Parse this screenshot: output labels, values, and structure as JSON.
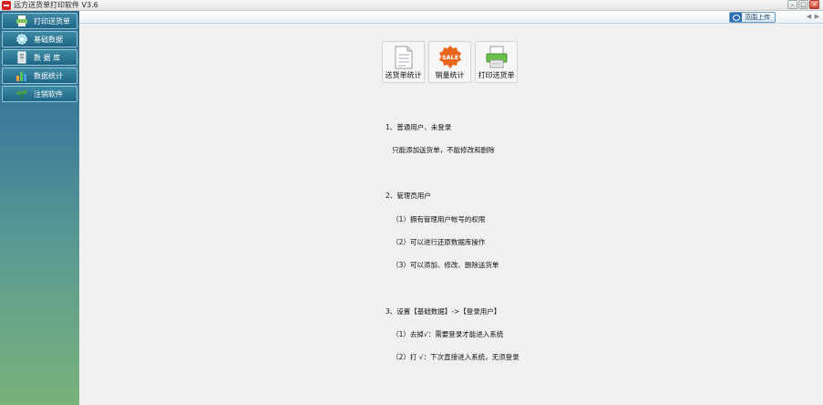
{
  "window": {
    "title": "远方送货单打印软件 V3.6",
    "controls": [
      "–",
      "□",
      "×"
    ]
  },
  "sidebar": {
    "items": [
      {
        "label": "打印送货单",
        "icon": "printer-icon"
      },
      {
        "label": "基础数据",
        "icon": "gear-icon"
      },
      {
        "label": "数 据 库",
        "icon": "database-icon"
      },
      {
        "label": "数据统计",
        "icon": "bar-chart-icon"
      },
      {
        "label": "注销软件",
        "icon": "plant-icon"
      }
    ]
  },
  "toolbar": {
    "upload_label": "范围上传",
    "nav_prev": "◀",
    "nav_next": "▶"
  },
  "tiles": [
    {
      "label": "送货单统计",
      "icon": "document-icon"
    },
    {
      "label": "销量统计",
      "icon": "sale-badge-icon",
      "badge_text": "SALE"
    },
    {
      "label": "打印送货单",
      "icon": "printer-icon"
    }
  ],
  "notes": [
    {
      "lines": [
        "1、普通用户、未登录",
        "   只能添加送货单，不能修改和删除"
      ]
    },
    {
      "lines": [
        "2、管理员用户",
        "   （1）拥有管理用户帐号的权限",
        "   （2）可以进行还原数据库操作",
        "   （3）可以添加、修改、删除送货单"
      ]
    },
    {
      "lines": [
        "3、设置【基础数据】->【登录用户】",
        "   （1）去掉√：需要登录才能进入系统",
        "   （2）打 √：下次直接进入系统，无须登录"
      ]
    }
  ],
  "colors": {
    "sidebar_top": "#2f6a8a",
    "sidebar_bottom": "#79b27a",
    "sale_badge": "#e8661c",
    "close_button": "#d04030"
  }
}
